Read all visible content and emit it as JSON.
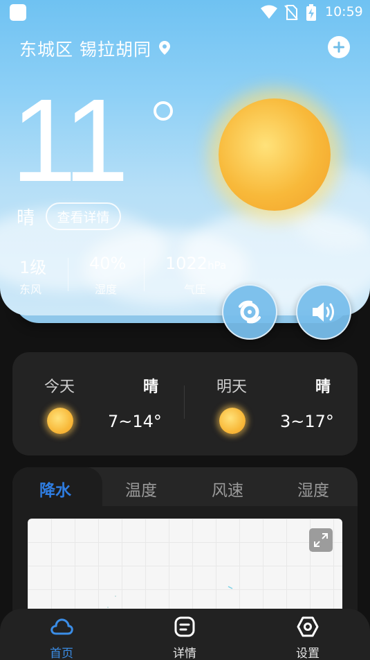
{
  "status_bar": {
    "time": "10:59"
  },
  "location": {
    "text": "东城区 锡拉胡同"
  },
  "current": {
    "temperature": "11",
    "condition": "晴",
    "detail_label": "查看详情",
    "wind_level": "1级",
    "wind_dir": "东风",
    "humidity": "40%",
    "humidity_label": "湿度",
    "pressure": "1022",
    "pressure_unit": "hPa",
    "pressure_label": "气压"
  },
  "forecast": {
    "today": {
      "day": "今天",
      "condition": "晴",
      "range": "7~14°"
    },
    "tomorrow": {
      "day": "明天",
      "condition": "晴",
      "range": "3~17°"
    }
  },
  "chart_tabs": [
    "降水",
    "温度",
    "风速",
    "湿度"
  ],
  "active_tab": 0,
  "nav": [
    {
      "label": "首页",
      "icon": "cloud-icon"
    },
    {
      "label": "详情",
      "icon": "details-icon"
    },
    {
      "label": "设置",
      "icon": "settings-icon"
    }
  ],
  "colors": {
    "accent": "#2f7de1",
    "sky_top": "#6fc2f2",
    "card_bg": "#232323",
    "page_bg": "#121212"
  }
}
